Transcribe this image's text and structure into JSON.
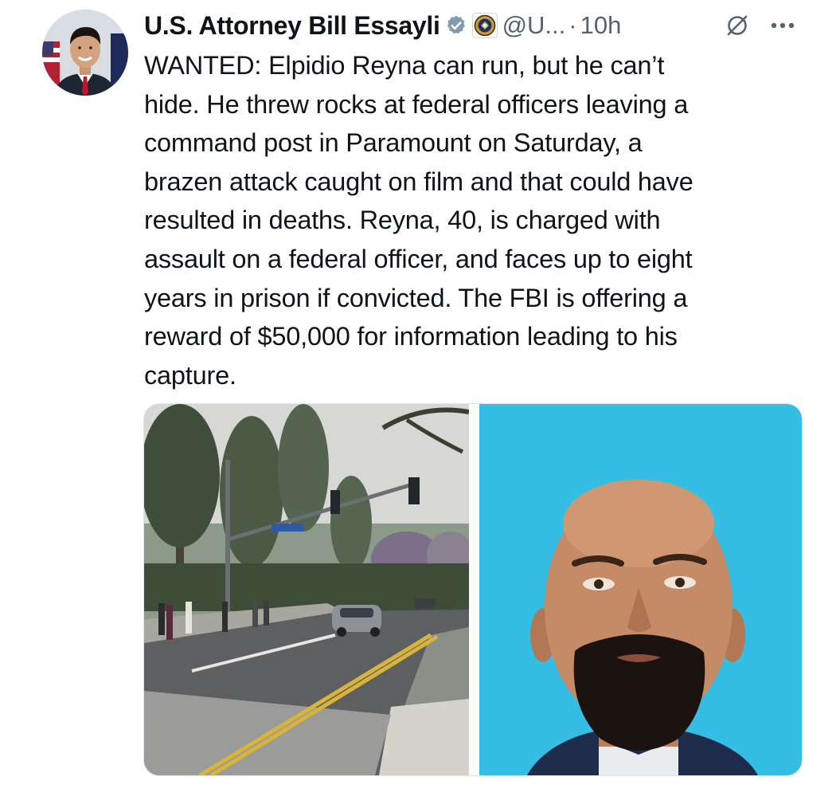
{
  "author": {
    "display_name": "U.S. Attorney Bill Essayli",
    "handle": "@U...",
    "separator": "·",
    "time": "10h",
    "verified_badge_icon": "verified-badge-icon",
    "affiliation_icon": "doj-seal-icon"
  },
  "actions": {
    "grok_icon": "grok-icon",
    "more_icon": "more-options-icon"
  },
  "text_lines": [
    "WANTED: Elpidio Reyna can run, but he can’t",
    "hide. He threw rocks at federal officers leaving a",
    "command post in Paramount on Saturday, a",
    "brazen attack caught on film and that could have",
    "resulted in deaths. Reyna, 40, is charged with",
    "assault on a federal officer, and faces up to eight",
    "years in prison if convicted. The FBI is offering a",
    "reward of $50,000 for information leading to his",
    "capture."
  ],
  "media": {
    "left_photo": "street-scene-photo",
    "right_photo": "mugshot-photo",
    "street_sign": "Alondra Blvd"
  },
  "colors": {
    "text": "#0f1419",
    "secondary": "#536471",
    "verified": "#829aab",
    "mugshot_background": "#35bde3"
  }
}
